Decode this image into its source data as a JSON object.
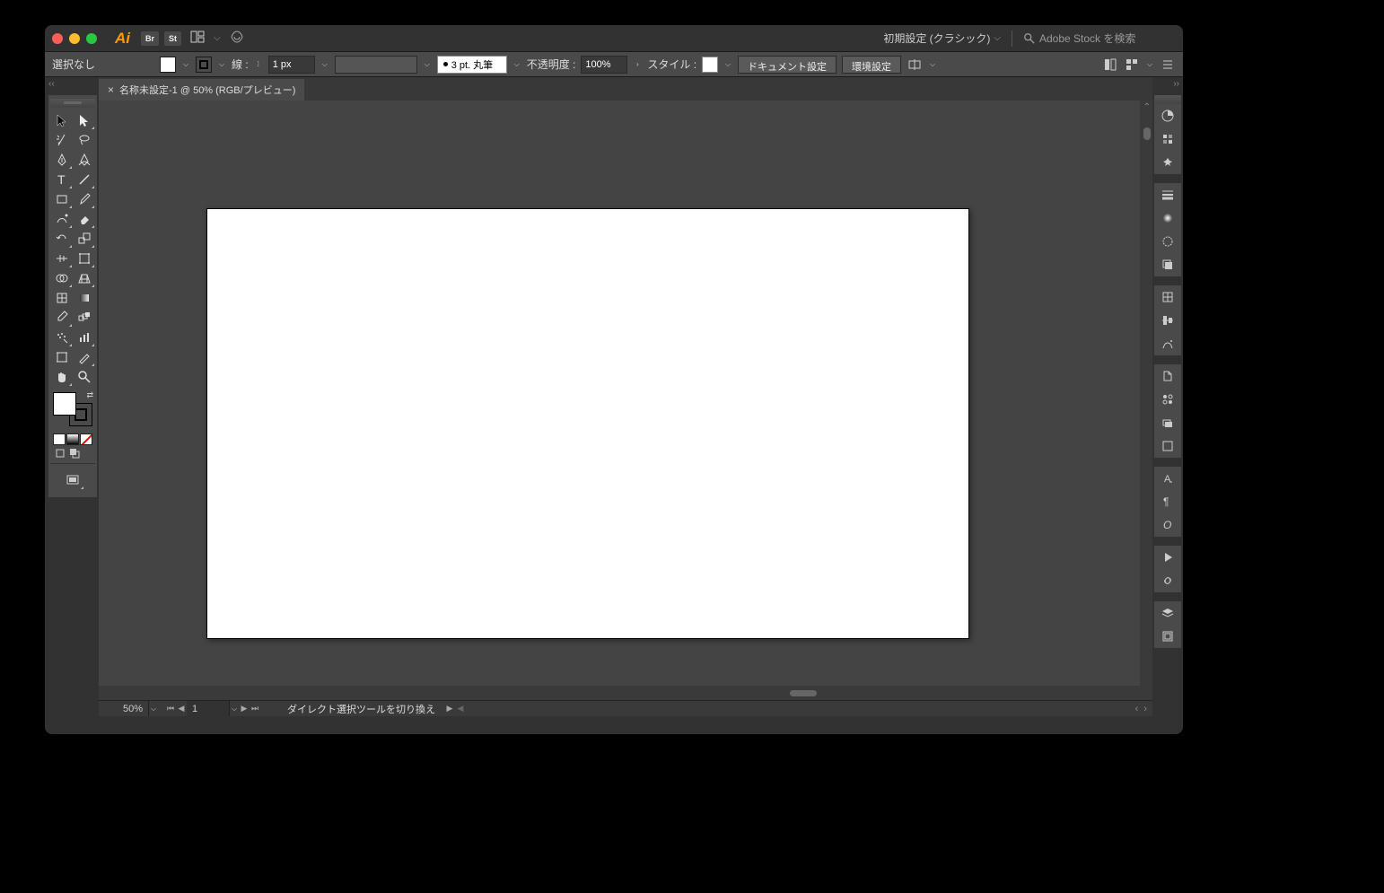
{
  "menubar": {
    "logo": "Ai",
    "badges": [
      "Br",
      "St"
    ],
    "workspace": "初期設定 (クラシック)",
    "search_placeholder": "Adobe Stock を検索"
  },
  "ctrlbar": {
    "selection": "選択なし",
    "stroke_label": "線 :",
    "stroke_weight": "1 px",
    "brush": "3 pt. 丸筆",
    "opacity_label": "不透明度 :",
    "opacity": "100%",
    "style_label": "スタイル :",
    "btn_docsetup": "ドキュメント設定",
    "btn_prefs": "環境設定"
  },
  "tab": {
    "title": "名称未設定-1 @ 50% (RGB/プレビュー)",
    "close": "×"
  },
  "status": {
    "zoom": "50%",
    "artboard": "1",
    "tip": "ダイレクト選択ツールを切り換え"
  },
  "rdock": [
    "color-icon",
    "swatches-icon",
    "color-guide-icon",
    "stroke-icon",
    "gradient-icon",
    "transparency-icon",
    "appearance-icon",
    "transform-icon",
    "align-icon",
    "pathfinder-icon",
    "graphic-styles-icon",
    "symbols-icon",
    "brushes-icon",
    "artboards-icon",
    "character-icon",
    "paragraph-icon",
    "opentype-icon",
    "play-icon",
    "links-icon",
    "layers-icon",
    "assets-icon"
  ]
}
